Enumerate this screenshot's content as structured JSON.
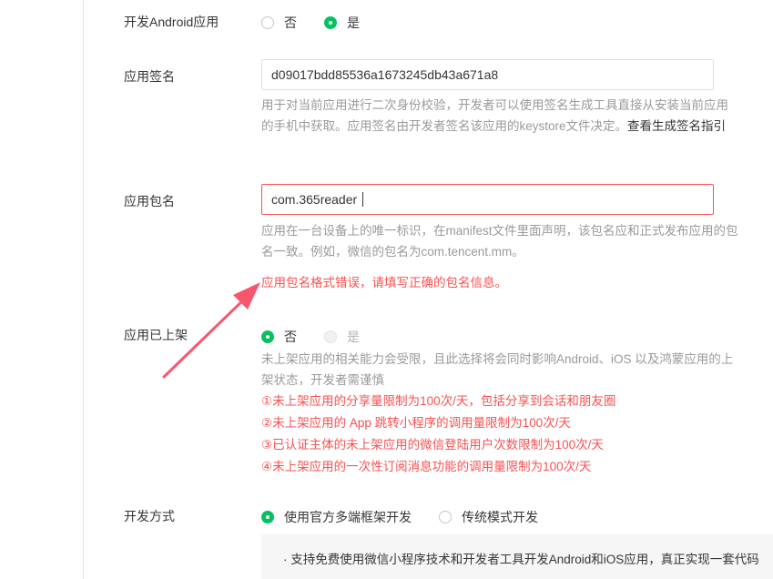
{
  "rows": {
    "android_dev": {
      "label": "开发Android应用",
      "options": [
        {
          "label": "否",
          "selected": false
        },
        {
          "label": "是",
          "selected": true
        }
      ]
    },
    "signature": {
      "label": "应用签名",
      "value": "d09017bdd85536a1673245db43a671a8",
      "help_text": "用于对当前应用进行二次身份校验，开发者可以使用签名生成工具直接从安装当前应用的手机中获取。应用签名由开发者签名该应用的keystore文件决定。",
      "help_link": "查看生成签名指引"
    },
    "package": {
      "label": "应用包名",
      "value": "com.365reader",
      "help_text": "应用在一台设备上的唯一标识，在manifest文件里面声明，该包名应和正式发布应用的包名一致。例如，微信的包名为com.tencent.mm。",
      "error": "应用包名格式错误，请填写正确的包名信息。"
    },
    "published": {
      "label": "应用已上架",
      "options": [
        {
          "label": "否",
          "selected": true
        },
        {
          "label": "是",
          "selected": false,
          "disabled": true
        }
      ],
      "help_text": "未上架应用的相关能力会受限，且此选择将会同时影响Android、iOS 以及鸿蒙应用的上架状态，开发者需谨慎",
      "warnings": [
        "①未上架应用的分享量限制为100次/天，包括分享到会话和朋友圈",
        "②未上架应用的 App 跳转小程序的调用量限制为100次/天",
        "③已认证主体的未上架应用的微信登陆用户次数限制为100次/天",
        "④未上架应用的一次性订阅消息功能的调用量限制为100次/天"
      ]
    },
    "dev_mode": {
      "label": "开发方式",
      "options": [
        {
          "label": "使用官方多端框架开发",
          "selected": true
        },
        {
          "label": "传统模式开发",
          "selected": false
        }
      ],
      "info": "· 支持免费使用微信小程序技术和开发者工具开发Android和iOS应用，真正实现一套代码"
    }
  },
  "colors": {
    "accent_green": "#07c160",
    "error_red": "#fa5151",
    "annotation_arrow": "#f7566d"
  }
}
